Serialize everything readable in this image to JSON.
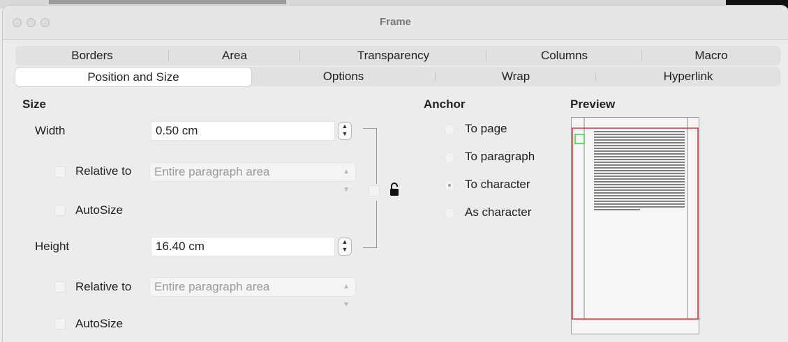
{
  "window": {
    "title": "Frame"
  },
  "tabs_row1": [
    {
      "label": "Borders"
    },
    {
      "label": "Area"
    },
    {
      "label": "Transparency"
    },
    {
      "label": "Columns"
    },
    {
      "label": "Macro"
    }
  ],
  "tabs_row2": [
    {
      "label": "Position and Size",
      "active": true
    },
    {
      "label": "Options"
    },
    {
      "label": "Wrap"
    },
    {
      "label": "Hyperlink"
    }
  ],
  "size": {
    "title": "Size",
    "width_label": "Width",
    "width_value": "0.50 cm",
    "width_relative_label": "Relative to",
    "width_relative_value": "Entire paragraph area",
    "width_autosize_label": "AutoSize",
    "height_label": "Height",
    "height_value": "16.40 cm",
    "height_relative_label": "Relative to",
    "height_relative_value": "Entire paragraph area",
    "height_autosize_label": "AutoSize"
  },
  "anchor": {
    "title": "Anchor",
    "options": [
      {
        "label": "To page",
        "selected": false
      },
      {
        "label": "To paragraph",
        "selected": false
      },
      {
        "label": "To character",
        "selected": true
      },
      {
        "label": "As character",
        "selected": false
      }
    ]
  },
  "preview": {
    "title": "Preview"
  },
  "colors": {
    "frame_outline": "#e03030",
    "anchor_marker": "#3fcf3f"
  },
  "icons": {
    "keep_ratio": "lock-icon"
  }
}
